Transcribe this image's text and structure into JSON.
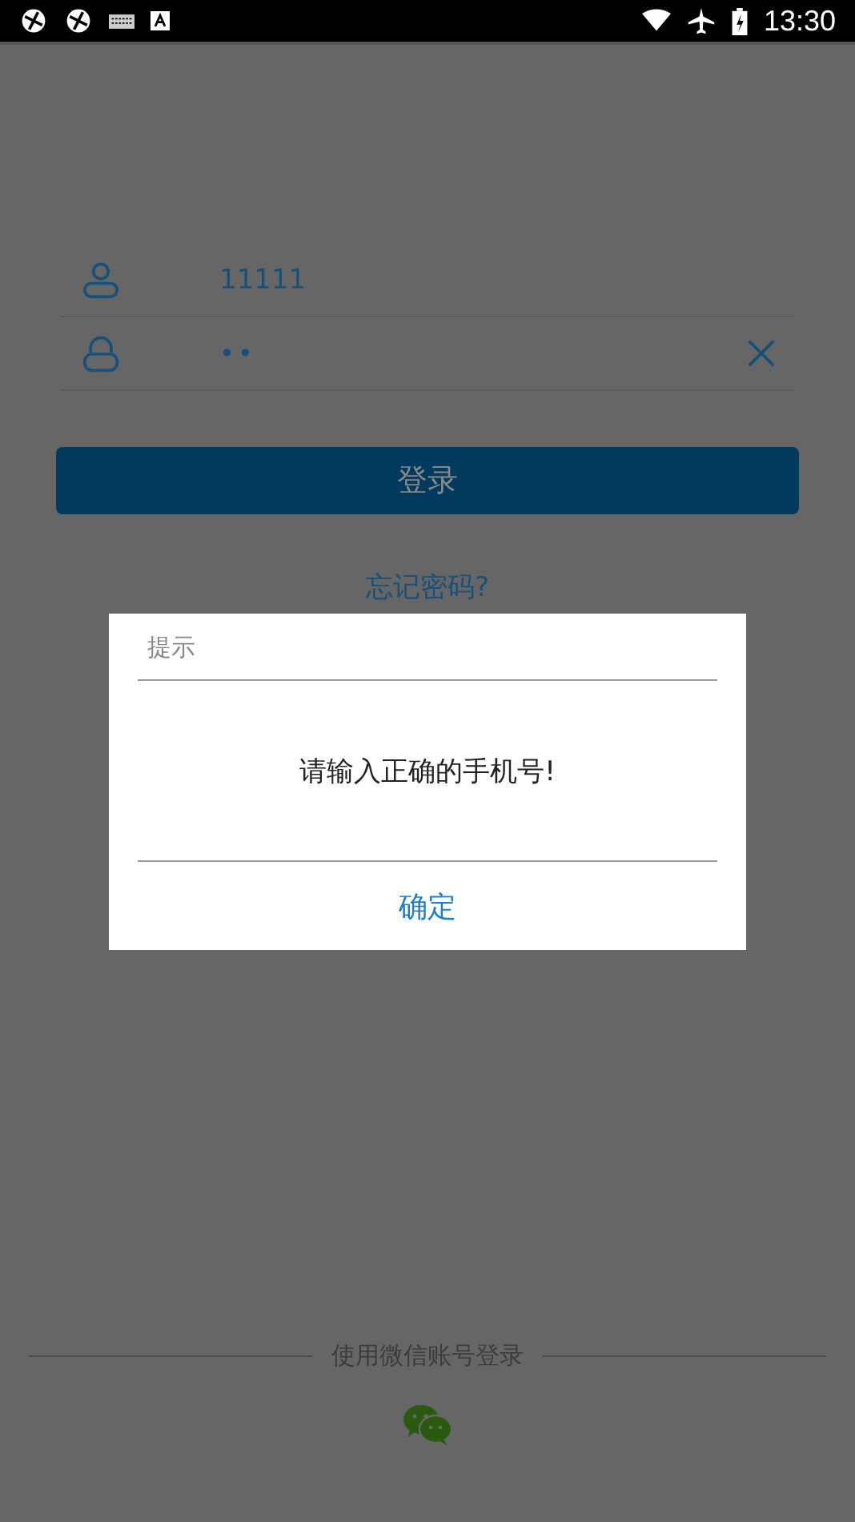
{
  "status_bar": {
    "time": "13:30"
  },
  "login_form": {
    "username": {
      "value": "11111"
    },
    "password": {
      "value": "••"
    },
    "login_button": "登录",
    "forgot_password_link": "忘记密码?"
  },
  "wechat_login": {
    "label": "使用微信账号登录"
  },
  "dialog": {
    "title": "提示",
    "message": "请输入正确的手机号!",
    "confirm_button": "确定"
  }
}
